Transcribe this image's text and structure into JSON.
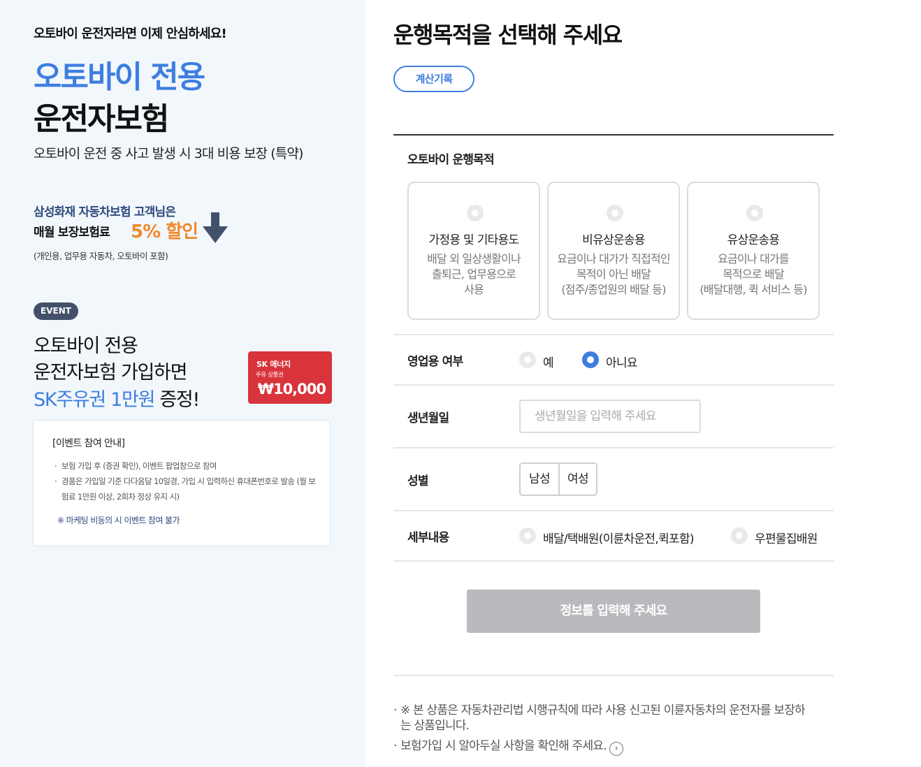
{
  "left": {
    "tagline": "오토바이 운전자라면 이제 안심하세요!",
    "title_line1": "오토바이 전용",
    "title_line2": "운전자보험",
    "description": "오토바이 운전 중 사고 발생 시 3대 비용 보장 (특약)",
    "promo": {
      "line1": "삼성화재 자동차보험 고객님은",
      "line2": "매월 보장보험료",
      "discount": "5% 할인",
      "note": "(개인용, 업무용 자동차, 오토바이 포함)"
    },
    "event": {
      "badge": "EVENT",
      "line1": "오토바이 전용",
      "line2": "운전자보험 가입하면",
      "line3_highlight": "SK주유권 1만원",
      "line3_rest": " 증정!",
      "voucher": {
        "brand": "SK 에너지",
        "subtitle": "주유 상품권",
        "amount": "₩10,000",
        "color": "#d9333b"
      },
      "box": {
        "title": "[이벤트 참여 안내]",
        "items": [
          "보험 가입 후 (증권 확인), 이벤트 팝업창으로 참여",
          "경품은 가입일 기준 다다음달 10일경, 가입 시 입력하신 휴대폰번호로 발송 (월 보험료 1만원 이상, 2회차 정상 유지 시)"
        ],
        "note": "※ 마케팅 비동의 시 이벤트 참여 불가"
      }
    }
  },
  "right": {
    "title": "운행목적을 선택해 주세요",
    "history_button": "계산기록",
    "purpose": {
      "label": "오토바이 운행목적",
      "cards": [
        {
          "title": "가정용 및 기타용도",
          "desc": [
            "배달 외 일상생활이나",
            "출퇴근, 업무용으로",
            "사용"
          ]
        },
        {
          "title": "비유상운송용",
          "desc": [
            "요금이나 대가가 직접적인",
            "목적이 아닌 배달",
            "(점주/종업원의 배달 등)"
          ]
        },
        {
          "title": "유상운송용",
          "desc": [
            "요금이나 대가를",
            "목적으로 배달",
            "(배달대행, 퀵 서비스 등)"
          ]
        }
      ]
    },
    "business_use": {
      "label": "영업용 여부",
      "options": [
        "예",
        "아니요"
      ],
      "selected": "아니요"
    },
    "birthdate": {
      "label": "생년월일",
      "value": "",
      "placeholder": "생년월일을 입력해 주세요"
    },
    "gender": {
      "label": "성별",
      "options": [
        "남성",
        "여성"
      ]
    },
    "details": {
      "label": "세부내용",
      "options": [
        "배달/택배원(이륜차운전,퀵포함)",
        "우편물집배원"
      ]
    },
    "submit_button": "정보를 입력해 주세요",
    "footnotes": [
      "※ 본 상품은 자동차관리법 시행규칙에 따라 사용 신고된 이륜자동차의 운전자를 보장하는 상품입니다.",
      "보험가입 시 알아두실 사항을 확인해 주세요."
    ]
  },
  "colors": {
    "accent": "#3d7ee0",
    "discount": "#f08a2a",
    "left_background": "#f2f7fc",
    "disabled_button": "#b8babd",
    "badge": "#43506a"
  },
  "icons": [
    "down-arrow-icon",
    "radio-icon",
    "chevron-right-circle-icon"
  ]
}
